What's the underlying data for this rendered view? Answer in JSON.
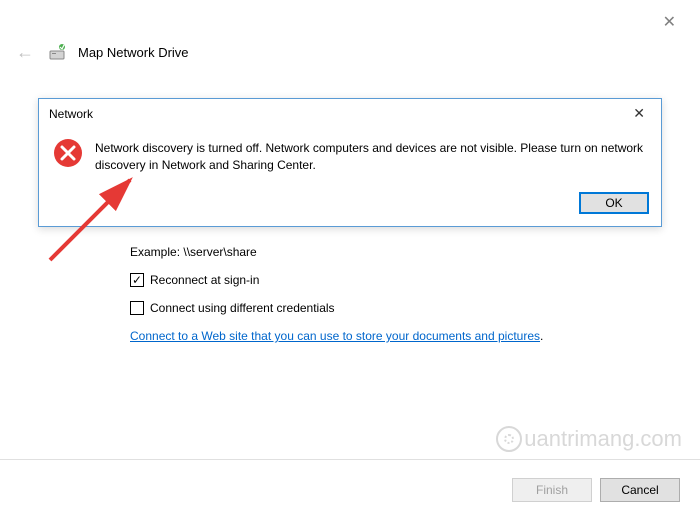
{
  "window": {
    "title": "Map Network Drive"
  },
  "content": {
    "example_label": "Example: \\\\server\\share",
    "reconnect_label": "Reconnect at sign-in",
    "credentials_label": "Connect using different credentials",
    "link_text": "Connect to a Web site that you can use to store your documents and pictures"
  },
  "footer": {
    "finish_label": "Finish",
    "cancel_label": "Cancel"
  },
  "dialog": {
    "title": "Network",
    "message": "Network discovery is turned off. Network computers and devices are not visible. Please turn on network discovery in Network and Sharing Center.",
    "ok_label": "OK"
  },
  "watermark": {
    "text": "uantrimang.com"
  }
}
